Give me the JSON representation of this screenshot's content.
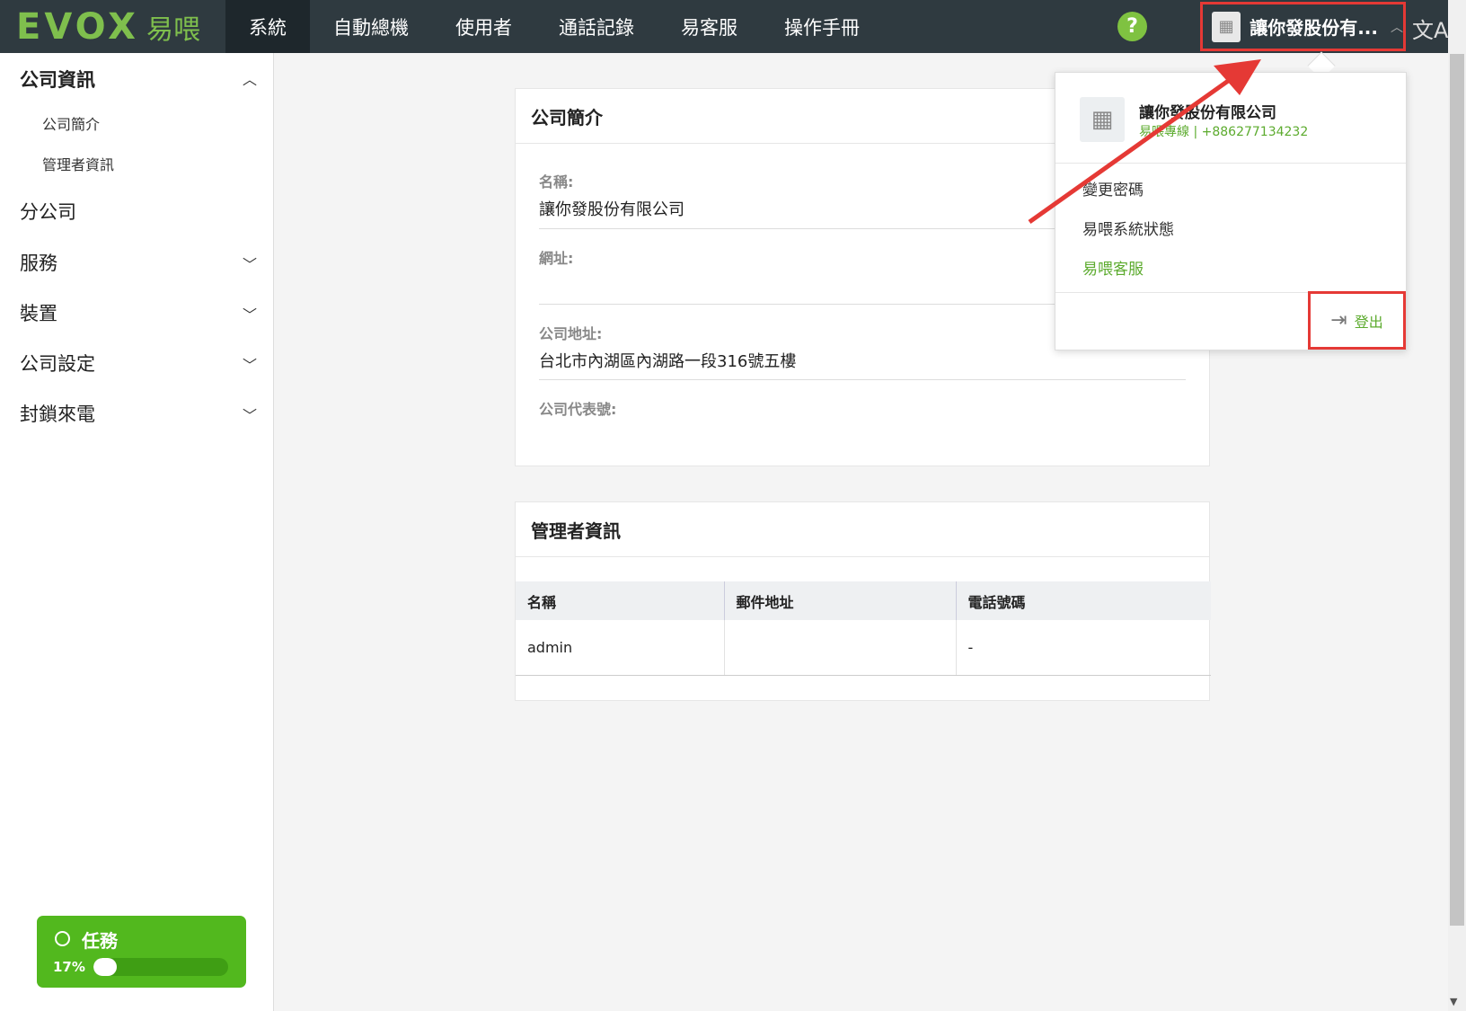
{
  "header": {
    "logo_text": "EVOX",
    "logo_cn": "易喂",
    "nav": [
      "系統",
      "自動總機",
      "使用者",
      "通話記錄",
      "易客服",
      "操作手冊"
    ],
    "help_glyph": "?",
    "company_short": "讓你發股份有...",
    "lang_glyph": "文A"
  },
  "sidebar": {
    "company_info": "公司資訊",
    "company_profile": "公司簡介",
    "admin_info": "管理者資訊",
    "branch": "分公司",
    "service": "服務",
    "device": "裝置",
    "company_settings": "公司設定",
    "block_calls": "封鎖來電",
    "task_label": "任務",
    "task_progress_text": "17%",
    "task_progress": 17
  },
  "profile_card": {
    "title": "公司簡介",
    "name_label": "名稱:",
    "name_value": "讓你發股份有限公司",
    "url_label": "網址:",
    "url_value": "",
    "address_label": "公司地址:",
    "address_value": "台北市內湖區內湖路一段316號五樓",
    "phone_label": "公司代表號:",
    "phone_value": ""
  },
  "admin_card": {
    "title": "管理者資訊",
    "columns": [
      "名稱",
      "郵件地址",
      "電話號碼"
    ],
    "rows": [
      [
        "admin",
        "",
        "-"
      ]
    ]
  },
  "dropdown": {
    "company_name": "讓你發股份有限公司",
    "company_sub": "易喂專線 | +886277134232",
    "change_password": "變更密碼",
    "system_status": "易喂系統狀態",
    "customer_service": "易喂客服",
    "logout": "登出"
  },
  "colors": {
    "accent_green": "#5cab2e",
    "highlight_red": "#e53935",
    "topbar": "#2f3a40"
  }
}
